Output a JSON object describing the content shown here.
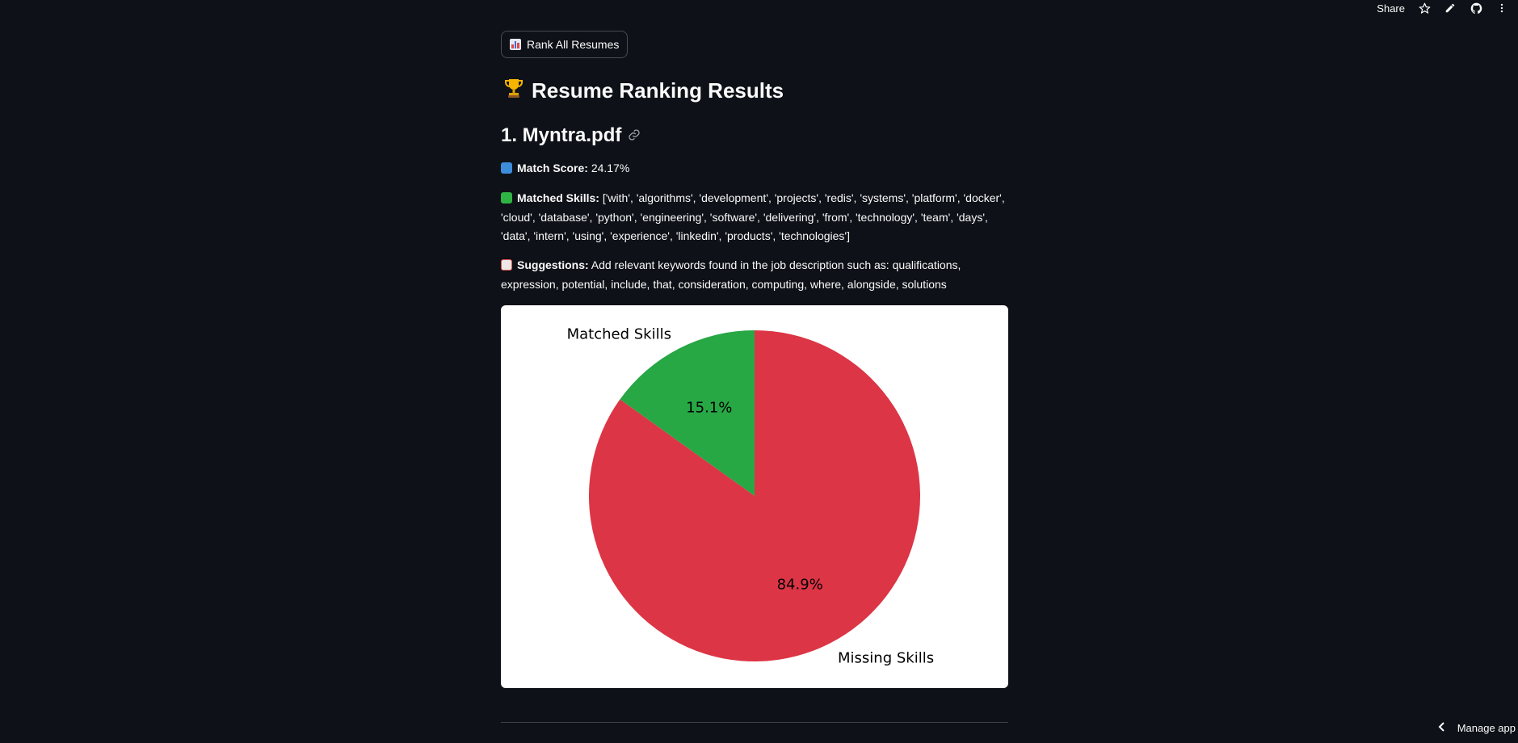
{
  "toolbar": {
    "share_label": "Share",
    "icons": [
      "star-icon",
      "pencil-icon",
      "github-icon",
      "more-vertical-icon"
    ]
  },
  "rank_button": {
    "icon": "bar-chart-icon",
    "label": "Rank All Resumes"
  },
  "results": {
    "title_icon": "trophy-icon",
    "title": "Resume Ranking Results"
  },
  "resume": {
    "heading": "1. Myntra.pdf",
    "heading_icon": "link-icon",
    "score": {
      "icon": "numbers-icon",
      "label": "Match Score:",
      "value": "24.17%"
    },
    "matched": {
      "icon": "check-mark-icon",
      "label": "Matched Skills:",
      "value": "['with', 'algorithms', 'development', 'projects', 'redis', 'systems', 'platform', 'docker', 'cloud', 'database', 'python', 'engineering', 'software', 'delivering', 'from', 'technology', 'team', 'days', 'data', 'intern', 'using', 'experience', 'linkedin', 'products', 'technologies']"
    },
    "suggestions": {
      "icon": "memo-icon",
      "label": "Suggestions:",
      "value": "Add relevant keywords found in the job description such as: qualifications, expression, potential, include, that, consideration, computing, where, alongside, solutions"
    }
  },
  "chart_data": {
    "type": "pie",
    "slices": [
      {
        "label": "Matched Skills",
        "value": 15.1,
        "pct_label": "15.1%",
        "color": "#28a745"
      },
      {
        "label": "Missing Skills",
        "value": 84.9,
        "pct_label": "84.9%",
        "color": "#dc3545"
      }
    ],
    "startangle": 90
  },
  "footer": {
    "manage_label": "Manage app"
  },
  "colors": {
    "background": "#0e1117",
    "text": "#fafafa",
    "matched": "#28a745",
    "missing": "#dc3545"
  }
}
